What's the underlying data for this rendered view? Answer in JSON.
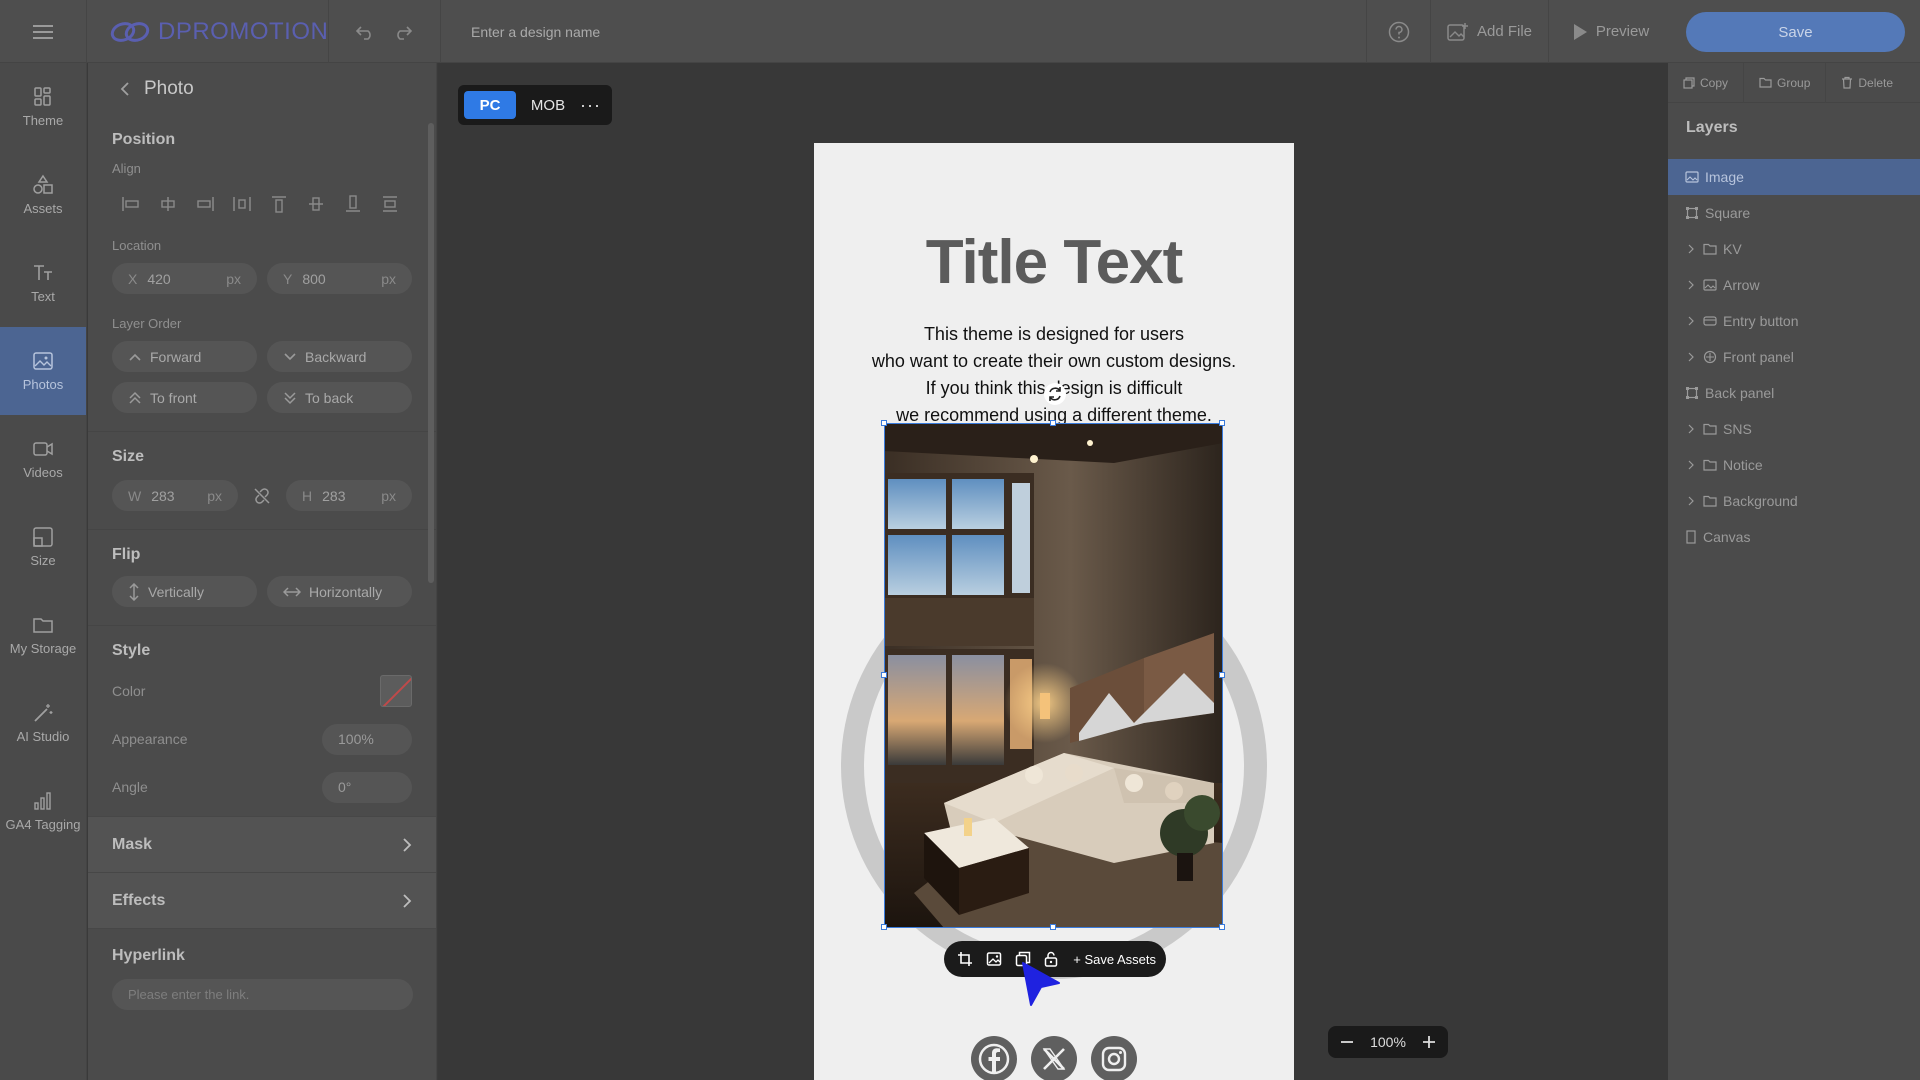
{
  "topbar": {
    "logo_text": "DPROMOTION",
    "design_name_placeholder": "Enter a design name",
    "add_file_label": "Add File",
    "preview_label": "Preview",
    "save_label": "Save"
  },
  "nav": {
    "items": [
      {
        "label": "Theme",
        "icon": "theme-icon"
      },
      {
        "label": "Assets",
        "icon": "assets-icon"
      },
      {
        "label": "Text",
        "icon": "text-icon"
      },
      {
        "label": "Photos",
        "icon": "photos-icon",
        "active": true
      },
      {
        "label": "Videos",
        "icon": "videos-icon"
      },
      {
        "label": "Size",
        "icon": "size-icon"
      },
      {
        "label": "My Storage",
        "icon": "folder-icon"
      },
      {
        "label": "AI Studio",
        "icon": "magic-wand-icon"
      },
      {
        "label": "GA4 Tagging",
        "icon": "bar-chart-icon"
      }
    ]
  },
  "panel": {
    "title": "Photo",
    "position_title": "Position",
    "align_label": "Align",
    "location_label": "Location",
    "x_prefix": "X",
    "x_value": "420",
    "y_prefix": "Y",
    "y_value": "800",
    "unit": "px",
    "layer_order_label": "Layer Order",
    "forward": "Forward",
    "backward": "Backward",
    "to_front": "To front",
    "to_back": "To back",
    "size_title": "Size",
    "w_prefix": "W",
    "w_value": "283",
    "h_prefix": "H",
    "h_value": "283",
    "flip_title": "Flip",
    "flip_vertical": "Vertically",
    "flip_horizontal": "Horizontally",
    "style_title": "Style",
    "color_label": "Color",
    "appearance_label": "Appearance",
    "appearance_value": "100%",
    "angle_label": "Angle",
    "angle_value": "0°",
    "mask_label": "Mask",
    "effects_label": "Effects",
    "hyperlink_title": "Hyperlink",
    "hyperlink_placeholder": "Please enter the link."
  },
  "canvas": {
    "pc_label": "PC",
    "mob_label": "MOB",
    "more_label": "···",
    "title_text": "Title Text",
    "body_lines": [
      "This theme is designed for users",
      "who want to create their own custom designs.",
      "If you think this design is difficult",
      "we recommend using a different theme."
    ],
    "save_assets_label": "+ Save Assets",
    "zoom_value": "100%"
  },
  "layers": {
    "copy_label": "Copy",
    "group_label": "Group",
    "delete_label": "Delete",
    "title": "Layers",
    "items": [
      {
        "label": "Image",
        "icon": "image-icon",
        "active": true
      },
      {
        "label": "Square",
        "icon": "square-icon"
      },
      {
        "label": "KV",
        "icon": "folder-icon",
        "expandable": true
      },
      {
        "label": "Arrow",
        "icon": "image-icon",
        "expandable": true
      },
      {
        "label": "Entry button",
        "icon": "button-icon",
        "expandable": true
      },
      {
        "label": "Front panel",
        "icon": "component-icon",
        "expandable": true
      },
      {
        "label": "Back panel",
        "icon": "square-icon"
      },
      {
        "label": "SNS",
        "icon": "folder-icon",
        "expandable": true
      },
      {
        "label": "Notice",
        "icon": "folder-icon",
        "expandable": true
      },
      {
        "label": "Background",
        "icon": "folder-icon",
        "expandable": true
      },
      {
        "label": "Canvas",
        "icon": "page-icon"
      }
    ]
  },
  "colors": {
    "accent": "#4c6592",
    "save_button": "#5479b8",
    "pc_active": "#2f7ae5",
    "selection": "#3a7bdc"
  }
}
